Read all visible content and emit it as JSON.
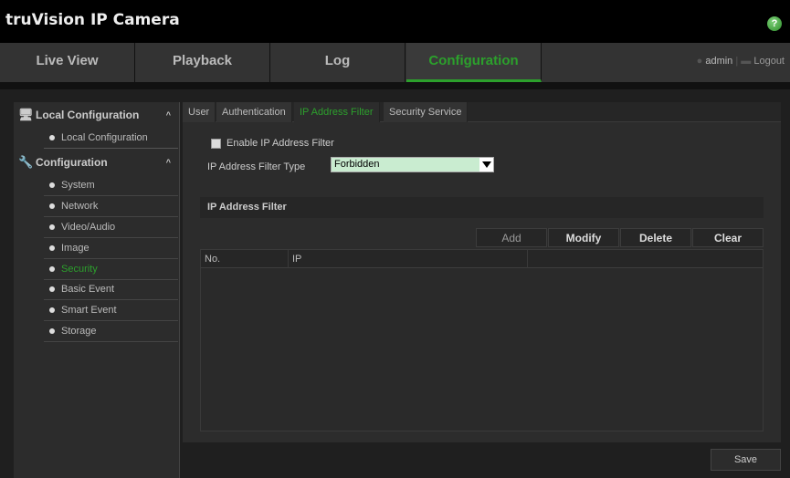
{
  "header": {
    "logo": "truVision  IP Camera",
    "help": "?"
  },
  "nav": {
    "tabs": [
      "Live View",
      "Playback",
      "Log",
      "Configuration"
    ],
    "active": "Configuration",
    "user": "admin",
    "logout": "Logout"
  },
  "sidebar": {
    "groups": [
      {
        "label": "Local Configuration",
        "items": [
          "Local Configuration"
        ]
      },
      {
        "label": "Configuration",
        "items": [
          "System",
          "Network",
          "Video/Audio",
          "Image",
          "Security",
          "Basic Event",
          "Smart Event",
          "Storage"
        ]
      }
    ],
    "active": "Security"
  },
  "tabs": [
    "User",
    "Authentication",
    "IP Address Filter",
    "Security Service"
  ],
  "form": {
    "enable_label": "Enable IP Address Filter",
    "enable_checked": false,
    "type_label": "IP Address Filter Type",
    "type_value": "Forbidden"
  },
  "section": {
    "title": "IP Address Filter",
    "buttons": [
      "Add",
      "Modify",
      "Delete",
      "Clear"
    ],
    "columns": [
      "No.",
      "IP",
      ""
    ]
  },
  "save": "Save",
  "colors": {
    "accent": "#2ca02c"
  }
}
